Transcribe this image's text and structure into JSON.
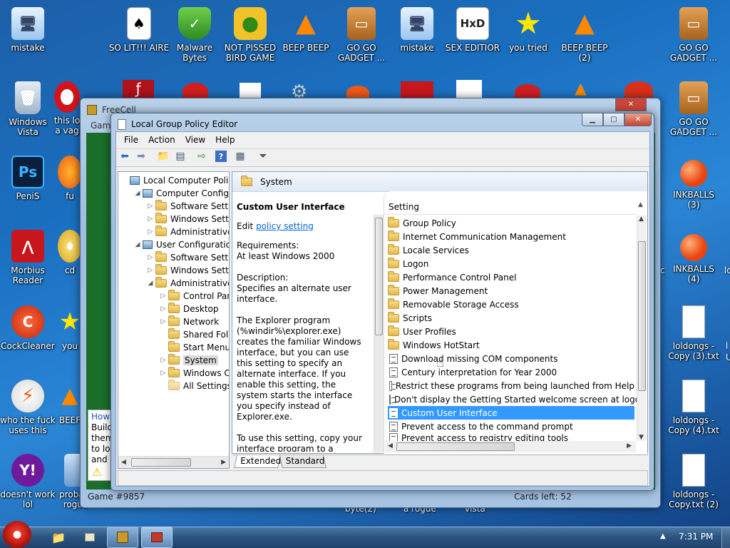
{
  "desktop_icons_left": [
    {
      "label": "mistake"
    },
    {
      "label": "Windows Vista"
    },
    {
      "label": "PeniS"
    },
    {
      "label": "Morbius Reader"
    },
    {
      "label": "CockCleaner"
    },
    {
      "label": "who the fuck uses this"
    },
    {
      "label": "doesn't work lol"
    }
  ],
  "desktop_icons_top": [
    {
      "label": "SO LIT!!! AIRE"
    },
    {
      "label": "Malware Bytes"
    },
    {
      "label": "NOT PISSED BIRD GAME"
    },
    {
      "label": "BEEP BEEP"
    },
    {
      "label": "GO GO GADGET ..."
    },
    {
      "label": "mistake"
    },
    {
      "label": "SEX EDITIOR"
    },
    {
      "label": "you tried"
    },
    {
      "label": "BEEP BEEP (2)"
    }
  ],
  "desktop_icons_right": [
    {
      "label": "GO GO GADGET ..."
    },
    {
      "label": "GO GO GADGET ..."
    },
    {
      "label": "INKBALLS (3)"
    },
    {
      "label": "INKBALLS (4)"
    },
    {
      "label": "loldongs - Copy (3).txt"
    },
    {
      "label": "loldongs - Copy (4).txt"
    },
    {
      "label": "loldongs - Copy.txt (2)"
    }
  ],
  "partial_icons": {
    "col2_row2": "this lo a vag",
    "col2_row3": "fu",
    "col2_row4": "cd",
    "col2_row5": "you",
    "col2_row6": "BEEF",
    "col2_row7": "proba a rogue",
    "bottom_mid1": "byte(2)",
    "bottom_mid2": "a rogue",
    "bottom_mid3": "vista",
    "right_partial1": "c",
    "right_partial2": "lo",
    "right_partial3": "l",
    "right_partial4": "U"
  },
  "freecell": {
    "title": "FreeCell",
    "menu_partial": "Game",
    "status_left": "Game #9857",
    "status_right": "Cards left: 52",
    "help_lines": [
      "How",
      "Build",
      "them",
      "to lo",
      "and l"
    ]
  },
  "gpedit": {
    "title": "Local Group Policy Editor",
    "menu": [
      "File",
      "Action",
      "View",
      "Help"
    ],
    "tree": [
      {
        "label": "Local Computer Policy",
        "depth": 0,
        "arrow": "",
        "icon": "computer"
      },
      {
        "label": "Computer Configura",
        "depth": 1,
        "arrow": "◢",
        "icon": "computer"
      },
      {
        "label": "Software Settings",
        "depth": 2,
        "arrow": "▷",
        "icon": "folder"
      },
      {
        "label": "Windows Setting",
        "depth": 2,
        "arrow": "▷",
        "icon": "folder"
      },
      {
        "label": "Administrative Te",
        "depth": 2,
        "arrow": "▷",
        "icon": "folder"
      },
      {
        "label": "User Configuration",
        "depth": 1,
        "arrow": "◢",
        "icon": "computer"
      },
      {
        "label": "Software Settings",
        "depth": 2,
        "arrow": "▷",
        "icon": "folder"
      },
      {
        "label": "Windows Setting",
        "depth": 2,
        "arrow": "▷",
        "icon": "folder"
      },
      {
        "label": "Administrative Te",
        "depth": 2,
        "arrow": "◢",
        "icon": "folder"
      },
      {
        "label": "Control Panel",
        "depth": 3,
        "arrow": "▷",
        "icon": "folder"
      },
      {
        "label": "Desktop",
        "depth": 3,
        "arrow": "▷",
        "icon": "folder"
      },
      {
        "label": "Network",
        "depth": 3,
        "arrow": "▷",
        "icon": "folder"
      },
      {
        "label": "Shared Folder",
        "depth": 3,
        "arrow": "",
        "icon": "folder"
      },
      {
        "label": "Start Menu ar",
        "depth": 3,
        "arrow": "",
        "icon": "folder"
      },
      {
        "label": "System",
        "depth": 3,
        "arrow": "▷",
        "icon": "folder",
        "selected": true
      },
      {
        "label": "Windows Cor",
        "depth": 3,
        "arrow": "▷",
        "icon": "folder"
      },
      {
        "label": "All Settings",
        "depth": 3,
        "arrow": "",
        "icon": "settings"
      }
    ],
    "header": "System",
    "desc": {
      "title": "Custom User Interface",
      "edit_prefix": "Edit ",
      "edit_link": "policy setting",
      "req_label": "Requirements:",
      "req_value": "At least Windows 2000",
      "desc_label": "Description:",
      "desc_value": "Specifies an alternate user interface.",
      "para1": "The Explorer program (%windir%\\explorer.exe) creates the familiar Windows interface, but you can use this setting to specify an alternate interface. If you enable this setting, the system starts the interface you specify instead of Explorer.exe.",
      "para2": "To use this setting, copy your interface program to a network share or to your system drive."
    },
    "list_header": "Setting",
    "list": [
      {
        "label": "Group Policy",
        "icon": "folder"
      },
      {
        "label": "Internet Communication Management",
        "icon": "folder"
      },
      {
        "label": "Locale Services",
        "icon": "folder"
      },
      {
        "label": "Logon",
        "icon": "folder"
      },
      {
        "label": "Performance Control Panel",
        "icon": "folder"
      },
      {
        "label": "Power Management",
        "icon": "folder"
      },
      {
        "label": "Removable Storage Access",
        "icon": "folder"
      },
      {
        "label": "Scripts",
        "icon": "folder"
      },
      {
        "label": "User Profiles",
        "icon": "folder"
      },
      {
        "label": "Windows HotStart",
        "icon": "folder"
      },
      {
        "label": "Download missing COM components",
        "icon": "doc"
      },
      {
        "label": "Century interpretation for Year 2000",
        "icon": "doc"
      },
      {
        "label": "Restrict these programs from being launched from Help",
        "icon": "doc"
      },
      {
        "label": "Don't display the Getting Started welcome screen at logon",
        "icon": "doc"
      },
      {
        "label": "Custom User Interface",
        "icon": "doc",
        "selected": true
      },
      {
        "label": "Prevent access to the command prompt",
        "icon": "doc"
      },
      {
        "label": "Prevent access to registry editing tools",
        "icon": "doc"
      }
    ],
    "tabs": [
      "Extended",
      "Standard"
    ]
  },
  "taskbar": {
    "time": "7:31 PM"
  },
  "colors": {
    "selection": "#3399ff",
    "link": "#0066cc",
    "felt": "#1a6e2a"
  }
}
